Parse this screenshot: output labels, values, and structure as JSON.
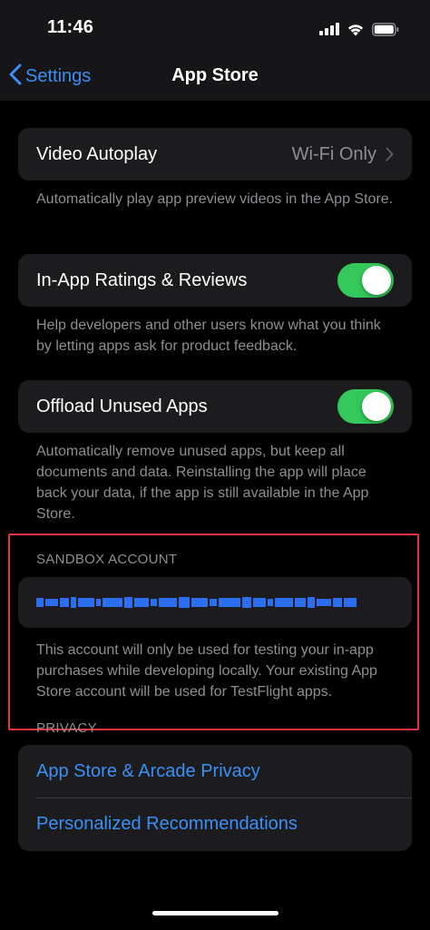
{
  "status_bar": {
    "time": "11:46",
    "signal_icon": "cellular-signal-icon",
    "wifi_icon": "wifi-icon",
    "battery_icon": "battery-icon"
  },
  "nav": {
    "back_label": "Settings",
    "back_icon": "chevron-left-icon",
    "title": "App Store"
  },
  "video_autoplay": {
    "label": "Video Autoplay",
    "value": "Wi-Fi Only",
    "footnote": "Automatically play app preview videos in the App Store."
  },
  "ratings": {
    "label": "In-App Ratings & Reviews",
    "enabled": true,
    "footnote": "Help developers and other users know what you think by letting apps ask for product feedback."
  },
  "offload": {
    "label": "Offload Unused Apps",
    "enabled": true,
    "footnote": "Automatically remove unused apps, but keep all documents and data. Reinstalling the app will place back your data, if the app is still available in the App Store."
  },
  "sandbox": {
    "header": "SANDBOX ACCOUNT",
    "footnote": "This account will only be used for testing your in-app purchases while developing locally. Your existing App Store account will be used for TestFlight apps."
  },
  "privacy": {
    "header": "PRIVACY",
    "links": [
      "App Store & Arcade Privacy",
      "Personalized Recommendations"
    ]
  },
  "colors": {
    "accent_blue": "#3b8ff6",
    "toggle_green": "#34c759",
    "highlight_red": "#e5343f",
    "redaction_blue": "#2b6ff0"
  }
}
